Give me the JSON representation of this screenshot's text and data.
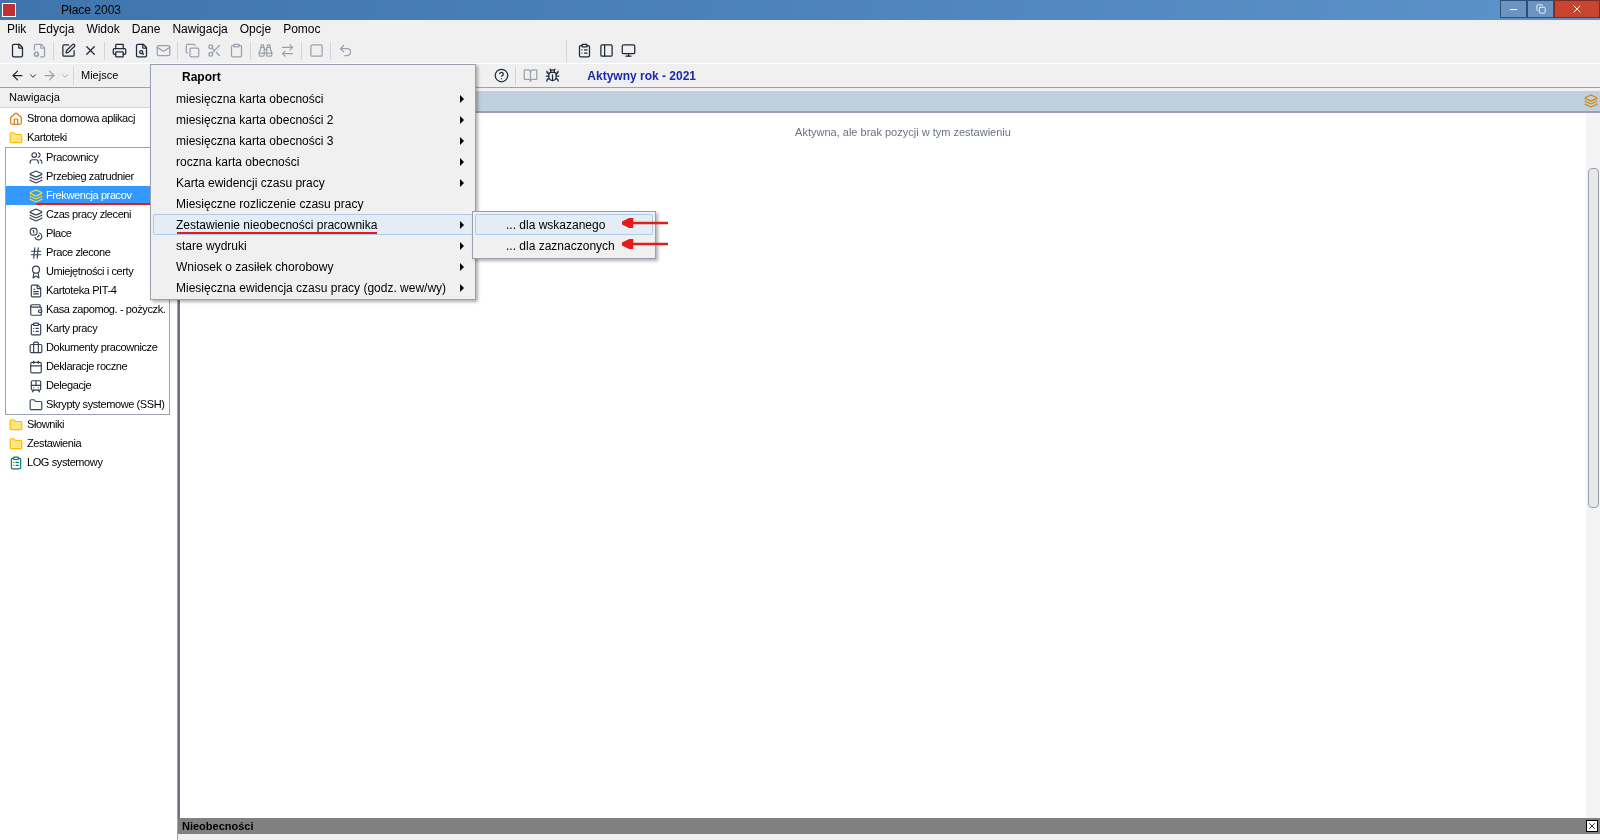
{
  "window": {
    "title": "Płace 2003"
  },
  "menu_bar": [
    "Plik",
    "Edycja",
    "Widok",
    "Dane",
    "Nawigacja",
    "Opcje",
    "Pomoc"
  ],
  "toolbar2": {
    "location_label": "Miejsce",
    "active_year": "Aktywny rok - 2021"
  },
  "navigation": {
    "header": "Nawigacja",
    "items": [
      {
        "label": "Strona domowa aplikacj",
        "kind": "home",
        "selected": false
      },
      {
        "label": "Kartoteki",
        "kind": "folder",
        "selected": false,
        "children": [
          {
            "label": "Pracownicy",
            "selected": false,
            "annotated": false
          },
          {
            "label": "Przebieg zatrudnier",
            "selected": false,
            "annotated": false
          },
          {
            "label": "Frekwencja pracov",
            "selected": true,
            "annotated": true
          },
          {
            "label": "Czas pracy zleceni",
            "selected": false,
            "annotated": false
          },
          {
            "label": "Płace",
            "selected": false,
            "annotated": false
          },
          {
            "label": "Prace zlecone",
            "selected": false,
            "annotated": false
          },
          {
            "label": "Umiejętności i certy",
            "selected": false,
            "annotated": false
          },
          {
            "label": "Kartoteka PIT-4",
            "selected": false,
            "annotated": false
          },
          {
            "label": "Kasa zapomog. - pożyczk.",
            "selected": false,
            "annotated": false
          },
          {
            "label": "Karty pracy",
            "selected": false,
            "annotated": false
          },
          {
            "label": "Dokumenty pracownicze",
            "selected": false,
            "annotated": false
          },
          {
            "label": "Deklaracje roczne",
            "selected": false,
            "annotated": false
          },
          {
            "label": "Delegacje",
            "selected": false,
            "annotated": false
          },
          {
            "label": "Skrypty systemowe (SSH)",
            "selected": false,
            "annotated": false
          }
        ]
      },
      {
        "label": "Słowniki",
        "kind": "folder",
        "selected": false
      },
      {
        "label": "Zestawienia",
        "kind": "folder",
        "selected": false
      },
      {
        "label": "LOG systemowy",
        "kind": "log",
        "selected": false
      }
    ]
  },
  "main": {
    "empty_message": "Aktywna, ale brak pozycji w tym zestawieniu"
  },
  "bottom_panel": {
    "title": "Nieobecności"
  },
  "context_menu": {
    "title": "Raport",
    "items": [
      {
        "label": "miesięczna karta obecności",
        "submenu": true,
        "selected": false,
        "annotated": false
      },
      {
        "label": "miesięczna karta obecności  2",
        "submenu": true,
        "selected": false,
        "annotated": false
      },
      {
        "label": "miesięczna karta obecności  3",
        "submenu": true,
        "selected": false,
        "annotated": false
      },
      {
        "label": "roczna karta obecności",
        "submenu": true,
        "selected": false,
        "annotated": false
      },
      {
        "label": "Karta ewidencji czasu pracy",
        "submenu": true,
        "selected": false,
        "annotated": false
      },
      {
        "label": "Miesięczne rozliczenie czasu pracy",
        "submenu": false,
        "selected": false,
        "annotated": false
      },
      {
        "label": "Zestawienie nieobecności pracownika",
        "submenu": true,
        "selected": true,
        "annotated": true
      },
      {
        "label": "stare wydruki",
        "submenu": true,
        "selected": false,
        "annotated": false
      },
      {
        "label": "Wniosek o zasiłek chorobowy",
        "submenu": true,
        "selected": false,
        "annotated": false
      },
      {
        "label": "Miesięczna ewidencja czasu pracy (godz. wew/wy)",
        "submenu": true,
        "selected": false,
        "annotated": false
      }
    ]
  },
  "submenu": {
    "items": [
      {
        "label": "... dla wskazanego",
        "selected": true,
        "annotated": true
      },
      {
        "label": "... dla zaznaczonych",
        "selected": false,
        "annotated": true
      }
    ]
  }
}
